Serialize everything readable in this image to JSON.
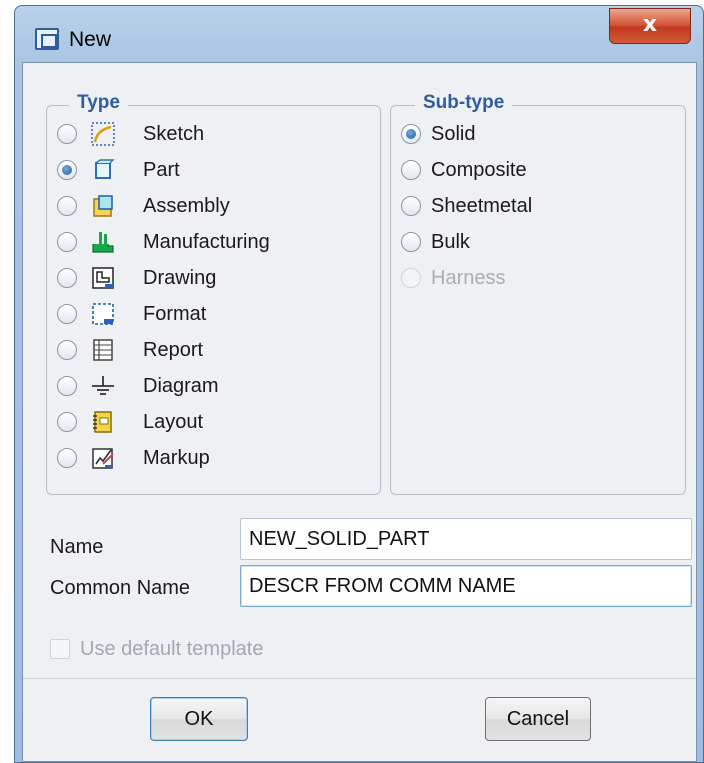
{
  "window": {
    "title": "New",
    "close_label": "x"
  },
  "type_group": {
    "legend": "Type",
    "items": [
      {
        "label": "Sketch",
        "icon": "sketch-icon",
        "selected": false
      },
      {
        "label": "Part",
        "icon": "part-icon",
        "selected": true
      },
      {
        "label": "Assembly",
        "icon": "assembly-icon",
        "selected": false
      },
      {
        "label": "Manufacturing",
        "icon": "manufacturing-icon",
        "selected": false
      },
      {
        "label": "Drawing",
        "icon": "drawing-icon",
        "selected": false
      },
      {
        "label": "Format",
        "icon": "format-icon",
        "selected": false
      },
      {
        "label": "Report",
        "icon": "report-icon",
        "selected": false
      },
      {
        "label": "Diagram",
        "icon": "diagram-icon",
        "selected": false
      },
      {
        "label": "Layout",
        "icon": "layout-icon",
        "selected": false
      },
      {
        "label": "Markup",
        "icon": "markup-icon",
        "selected": false
      }
    ]
  },
  "subtype_group": {
    "legend": "Sub-type",
    "items": [
      {
        "label": "Solid",
        "selected": true,
        "enabled": true
      },
      {
        "label": "Composite",
        "selected": false,
        "enabled": true
      },
      {
        "label": "Sheetmetal",
        "selected": false,
        "enabled": true
      },
      {
        "label": "Bulk",
        "selected": false,
        "enabled": true
      },
      {
        "label": "Harness",
        "selected": false,
        "enabled": false
      }
    ]
  },
  "form": {
    "name_label": "Name",
    "name_value": "NEW_SOLID_PART",
    "common_name_label": "Common Name",
    "common_name_value": "DESCR FROM COMM NAME",
    "template_label": "Use default template",
    "template_checked": false,
    "template_enabled": false
  },
  "buttons": {
    "ok_label": "OK",
    "cancel_label": "Cancel"
  },
  "colors": {
    "legend": "#2f5d9f",
    "close_button": "#c2391c",
    "window_frame": "#a9c4e2",
    "disabled_text": "#a9aeb5"
  }
}
